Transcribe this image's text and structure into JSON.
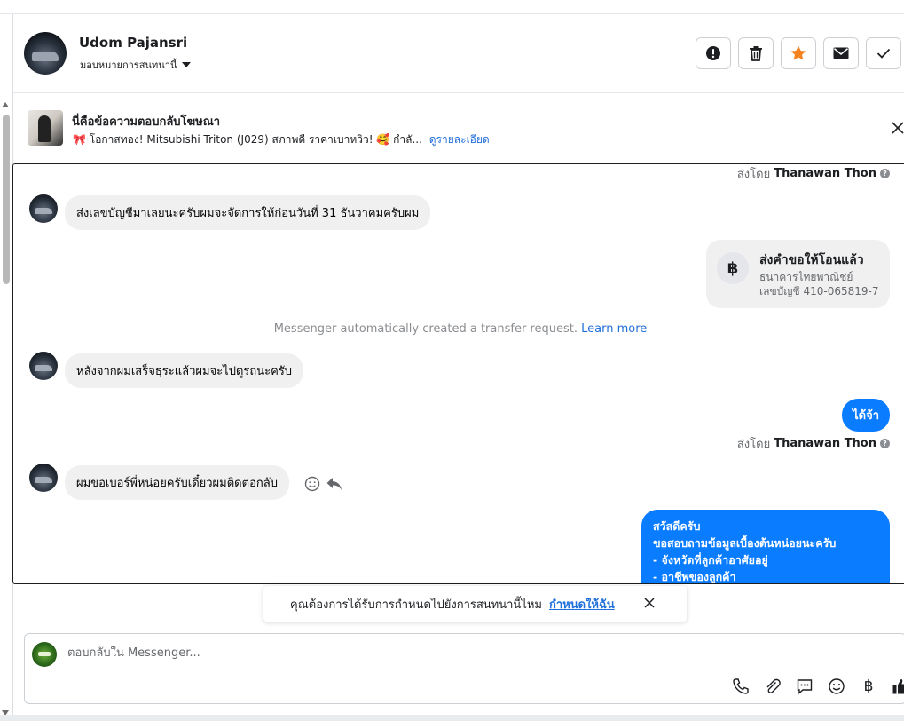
{
  "header": {
    "name": "Udom Pajansri",
    "assign_label": "มอบหมายการสนทนานี้"
  },
  "banner": {
    "title": "นี่คือข้อความตอบกลับโฆษณา",
    "snippet": "🎀 โอกาสทอง! Mitsubishi Triton (J029) สภาพดี ราคาเบาหวิว! 🥰 กำลั...",
    "details_link": "ดูรายละเอียด"
  },
  "thread": {
    "sent_by_label": "ส่งโดย",
    "sender_name": "Thanawan Thon",
    "messages": [
      {
        "text": "ส่งเลขบัญชีมาเลยนะครับผมจะจัดการให้ก่อนวันที่ 31 ธันวาคมครับผม"
      },
      {
        "text": "หลังจากผมเสร็จธุระแล้วผมจะไปดูรถนะครับ"
      },
      {
        "text": "ได้จ้า"
      },
      {
        "text": "ผมขอเบอร์พี่หน่อยครับเดี๋ยวผมติดต่อกลับ"
      }
    ],
    "transfer": {
      "currency_symbol": "฿",
      "title": "ส่งคำขอให้โอนแล้ว",
      "bank": "ธนาคารไทยพาณิชย์",
      "account": "เลขบัญชี 410-065819-7"
    },
    "system_note": "Messenger automatically created a transfer request.",
    "system_link": "Learn more",
    "long_message": {
      "line1": "สวัสดีครับ",
      "line2": "ขอสอบถามข้อมูลเบื้องต้นหน่อยนะครับ",
      "line3": "- จังหวัดที่ลูกค้าอาศัยอยู่",
      "line4": "- อาชีพของลูกค้า"
    }
  },
  "toast": {
    "text": "คุณต้องการได้รับการกำหนดไปยังการสนทนานี้ไหม",
    "link": "กำหนดให้ฉัน"
  },
  "composer": {
    "placeholder": "ตอบกลับใน Messenger...",
    "baht_symbol": "฿"
  }
}
